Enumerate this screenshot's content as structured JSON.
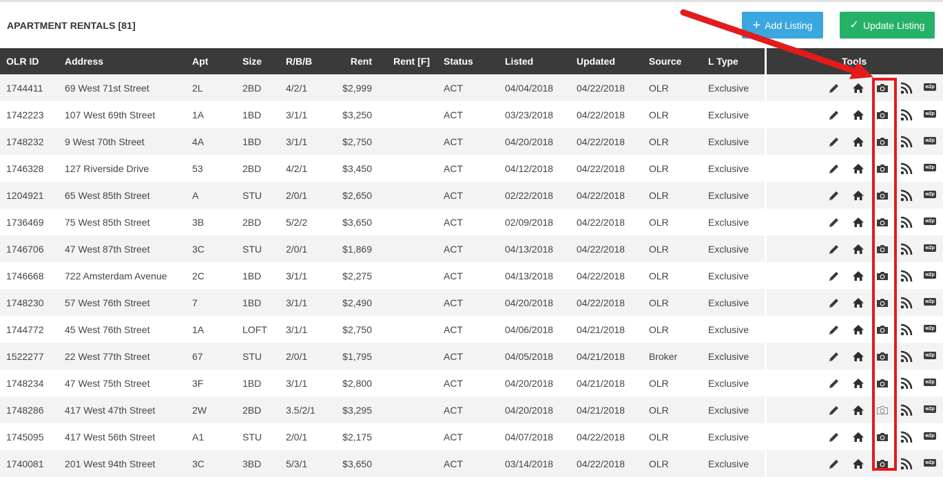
{
  "header": {
    "title": "APARTMENT RENTALS [81]",
    "add_label": "Add Listing",
    "add_icon": "plus-icon",
    "update_label": "Update Listing",
    "update_icon": "check-icon"
  },
  "colors": {
    "add_button": "#3aa7de",
    "update_button": "#26b169",
    "header_bg": "#3a3a3a",
    "annotation": "#e31b1b"
  },
  "columns": {
    "olr_id": "OLR ID",
    "address": "Address",
    "apt": "Apt",
    "size": "Size",
    "rbb": "R/B/B",
    "rent": "Rent",
    "rent_f": "Rent [F]",
    "status": "Status",
    "listed": "Listed",
    "updated": "Updated",
    "source": "Source",
    "ltype": "L Type",
    "tools": "Tools"
  },
  "tool_icons": [
    "edit-icon",
    "home-icon",
    "camera-icon",
    "rss-icon",
    "w2p-icon"
  ],
  "tool_w2p_text": "w2p",
  "rows": [
    {
      "id": "1744411",
      "address": "69 West 71st Street",
      "apt": "2L",
      "size": "2BD",
      "rbb": "4/2/1",
      "rent": "$2,999",
      "rent_f": "",
      "status": "ACT",
      "listed": "04/04/2018",
      "updated": "04/22/2018",
      "source": "OLR",
      "ltype": "Exclusive",
      "has_photo": true
    },
    {
      "id": "1742223",
      "address": "107 West 69th Street",
      "apt": "1A",
      "size": "1BD",
      "rbb": "3/1/1",
      "rent": "$3,250",
      "rent_f": "",
      "status": "ACT",
      "listed": "03/23/2018",
      "updated": "04/22/2018",
      "source": "OLR",
      "ltype": "Exclusive",
      "has_photo": true
    },
    {
      "id": "1748232",
      "address": "9 West 70th Street",
      "apt": "4A",
      "size": "1BD",
      "rbb": "3/1/1",
      "rent": "$2,750",
      "rent_f": "",
      "status": "ACT",
      "listed": "04/20/2018",
      "updated": "04/22/2018",
      "source": "OLR",
      "ltype": "Exclusive",
      "has_photo": true
    },
    {
      "id": "1746328",
      "address": "127 Riverside Drive",
      "apt": "53",
      "size": "2BD",
      "rbb": "4/2/1",
      "rent": "$3,450",
      "rent_f": "",
      "status": "ACT",
      "listed": "04/12/2018",
      "updated": "04/22/2018",
      "source": "OLR",
      "ltype": "Exclusive",
      "has_photo": true
    },
    {
      "id": "1204921",
      "address": "65 West 85th Street",
      "apt": "A",
      "size": "STU",
      "rbb": "2/0/1",
      "rent": "$2,650",
      "rent_f": "",
      "status": "ACT",
      "listed": "02/22/2018",
      "updated": "04/22/2018",
      "source": "OLR",
      "ltype": "Exclusive",
      "has_photo": true
    },
    {
      "id": "1736469",
      "address": "75 West 85th Street",
      "apt": "3B",
      "size": "2BD",
      "rbb": "5/2/2",
      "rent": "$3,650",
      "rent_f": "",
      "status": "ACT",
      "listed": "02/09/2018",
      "updated": "04/22/2018",
      "source": "OLR",
      "ltype": "Exclusive",
      "has_photo": true
    },
    {
      "id": "1746706",
      "address": "47 West 87th Street",
      "apt": "3C",
      "size": "STU",
      "rbb": "2/0/1",
      "rent": "$1,869",
      "rent_f": "",
      "status": "ACT",
      "listed": "04/13/2018",
      "updated": "04/22/2018",
      "source": "OLR",
      "ltype": "Exclusive",
      "has_photo": true
    },
    {
      "id": "1746668",
      "address": "722 Amsterdam Avenue",
      "apt": "2C",
      "size": "1BD",
      "rbb": "3/1/1",
      "rent": "$2,275",
      "rent_f": "",
      "status": "ACT",
      "listed": "04/13/2018",
      "updated": "04/22/2018",
      "source": "OLR",
      "ltype": "Exclusive",
      "has_photo": true
    },
    {
      "id": "1748230",
      "address": "57 West 76th Street",
      "apt": "7",
      "size": "1BD",
      "rbb": "3/1/1",
      "rent": "$2,490",
      "rent_f": "",
      "status": "ACT",
      "listed": "04/20/2018",
      "updated": "04/22/2018",
      "source": "OLR",
      "ltype": "Exclusive",
      "has_photo": true
    },
    {
      "id": "1744772",
      "address": "45 West 76th Street",
      "apt": "1A",
      "size": "LOFT",
      "rbb": "3/1/1",
      "rent": "$2,750",
      "rent_f": "",
      "status": "ACT",
      "listed": "04/06/2018",
      "updated": "04/21/2018",
      "source": "OLR",
      "ltype": "Exclusive",
      "has_photo": true
    },
    {
      "id": "1522277",
      "address": "22 West 77th Street",
      "apt": "67",
      "size": "STU",
      "rbb": "2/0/1",
      "rent": "$1,795",
      "rent_f": "",
      "status": "ACT",
      "listed": "04/05/2018",
      "updated": "04/21/2018",
      "source": "Broker",
      "ltype": "Exclusive",
      "has_photo": true
    },
    {
      "id": "1748234",
      "address": "47 West 75th Street",
      "apt": "3F",
      "size": "1BD",
      "rbb": "3/1/1",
      "rent": "$2,800",
      "rent_f": "",
      "status": "ACT",
      "listed": "04/20/2018",
      "updated": "04/21/2018",
      "source": "OLR",
      "ltype": "Exclusive",
      "has_photo": true
    },
    {
      "id": "1748286",
      "address": "417 West 47th Street",
      "apt": "2W",
      "size": "2BD",
      "rbb": "3.5/2/1",
      "rent": "$3,295",
      "rent_f": "",
      "status": "ACT",
      "listed": "04/20/2018",
      "updated": "04/21/2018",
      "source": "OLR",
      "ltype": "Exclusive",
      "has_photo": false
    },
    {
      "id": "1745095",
      "address": "417 West 56th Street",
      "apt": "A1",
      "size": "STU",
      "rbb": "2/0/1",
      "rent": "$2,175",
      "rent_f": "",
      "status": "ACT",
      "listed": "04/07/2018",
      "updated": "04/22/2018",
      "source": "OLR",
      "ltype": "Exclusive",
      "has_photo": true
    },
    {
      "id": "1740081",
      "address": "201 West 94th Street",
      "apt": "3C",
      "size": "3BD",
      "rbb": "5/3/1",
      "rent": "$3,650",
      "rent_f": "",
      "status": "ACT",
      "listed": "03/14/2018",
      "updated": "04/22/2018",
      "source": "OLR",
      "ltype": "Exclusive",
      "has_photo": true
    }
  ]
}
